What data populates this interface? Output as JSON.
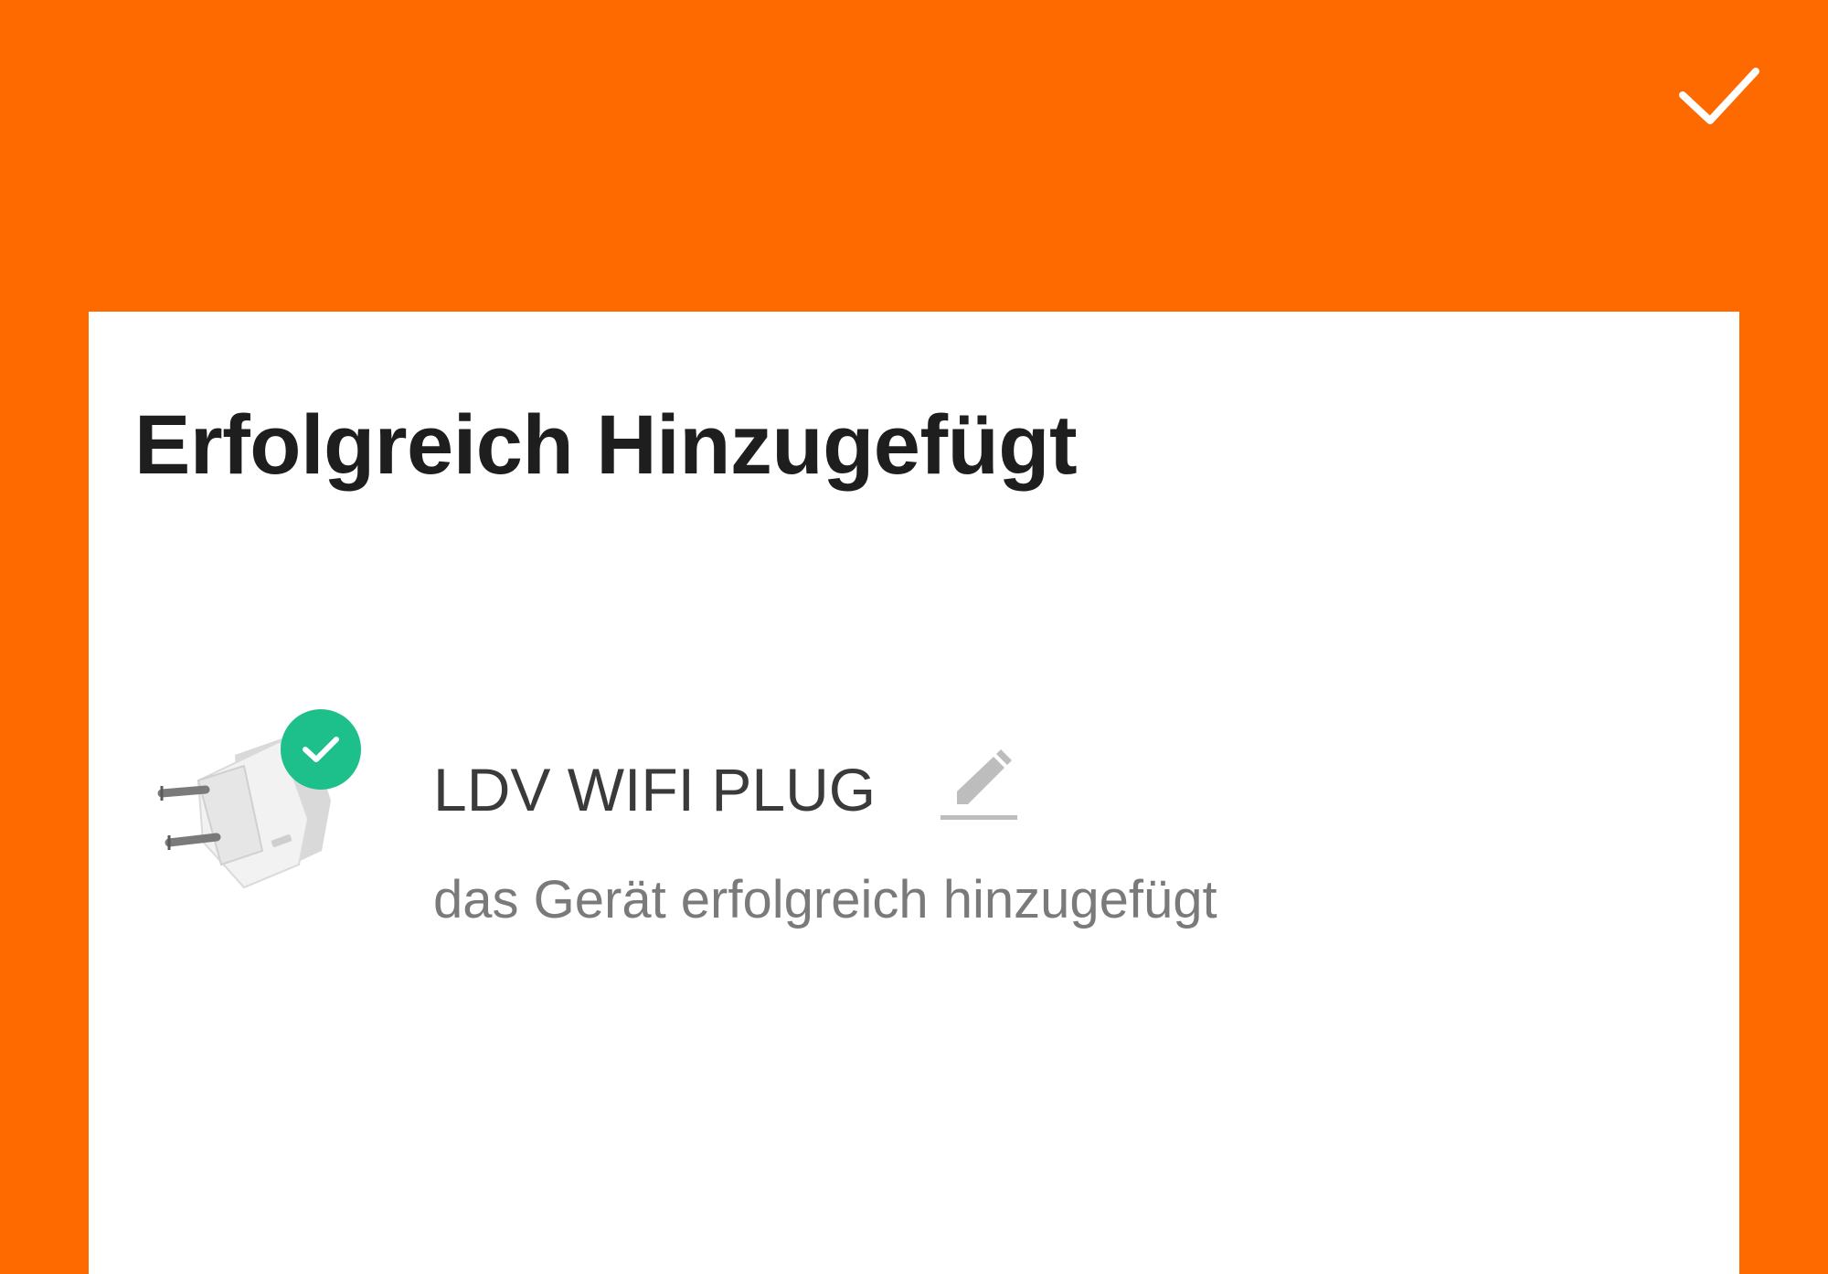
{
  "header": {
    "done_icon": "checkmark-icon",
    "background_color": "#FF6A00"
  },
  "card": {
    "title": "Erfolgreich Hinzugefügt",
    "device": {
      "name": "LDV WIFI PLUG",
      "status": "das Gerät erfolgreich hinzugefügt",
      "image_icon": "smart-plug-icon",
      "badge_icon": "check-circle-icon",
      "badge_color": "#1DBF8A",
      "edit_icon": "pencil-icon"
    }
  }
}
